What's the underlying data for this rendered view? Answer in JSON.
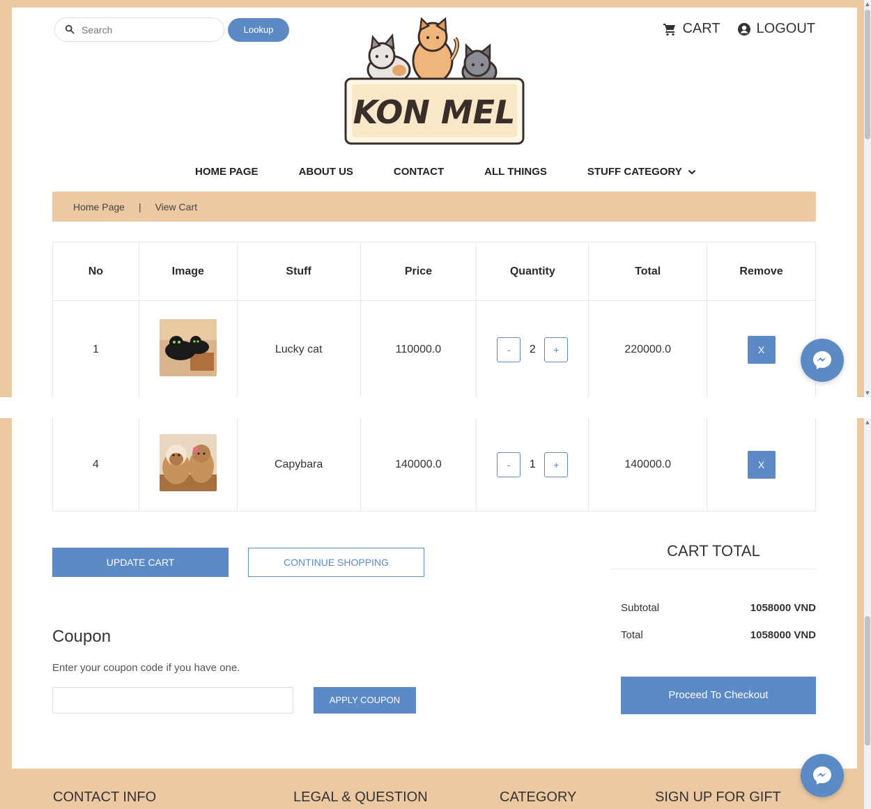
{
  "header": {
    "search_placeholder": "Search",
    "lookup_label": "Lookup",
    "cart_label": "CART",
    "logout_label": "LOGOUT",
    "logo_text": "KON MEL"
  },
  "nav": {
    "items": [
      "HOME PAGE",
      "ABOUT US",
      "CONTACT",
      "ALL THINGS",
      "STUFF CATEGORY"
    ]
  },
  "breadcrumb": {
    "home": "Home Page",
    "separator": "|",
    "current": "View Cart"
  },
  "cart_table": {
    "headers": [
      "No",
      "Image",
      "Stuff",
      "Price",
      "Quantity",
      "Total",
      "Remove"
    ],
    "rows": [
      {
        "no": "1",
        "stuff": "Lucky cat",
        "price": "110000.0",
        "quantity": "2",
        "total": "220000.0",
        "remove": "X",
        "minus": "-",
        "plus": "+"
      },
      {
        "no": "4",
        "stuff": "Capybara",
        "price": "140000.0",
        "quantity": "1",
        "total": "140000.0",
        "remove": "X",
        "minus": "-",
        "plus": "+"
      }
    ]
  },
  "actions": {
    "update_cart": "UPDATE CART",
    "continue_shopping": "CONTINUE SHOPPING"
  },
  "cart_total": {
    "title": "CART TOTAL",
    "subtotal_label": "Subtotal",
    "subtotal_value": "1058000 VND",
    "total_label": "Total",
    "total_value": "1058000 VND",
    "checkout_label": "Proceed To Checkout"
  },
  "coupon": {
    "title": "Coupon",
    "description": "Enter your coupon code if you have one.",
    "apply_label": "APPLY COUPON"
  },
  "footer": {
    "columns": [
      "CONTACT INFO",
      "LEGAL & QUESTION",
      "CATEGORY",
      "SIGN UP FOR GIFT"
    ]
  },
  "colors": {
    "accent": "#5b8ac4",
    "frame": "#ecc9a2"
  }
}
